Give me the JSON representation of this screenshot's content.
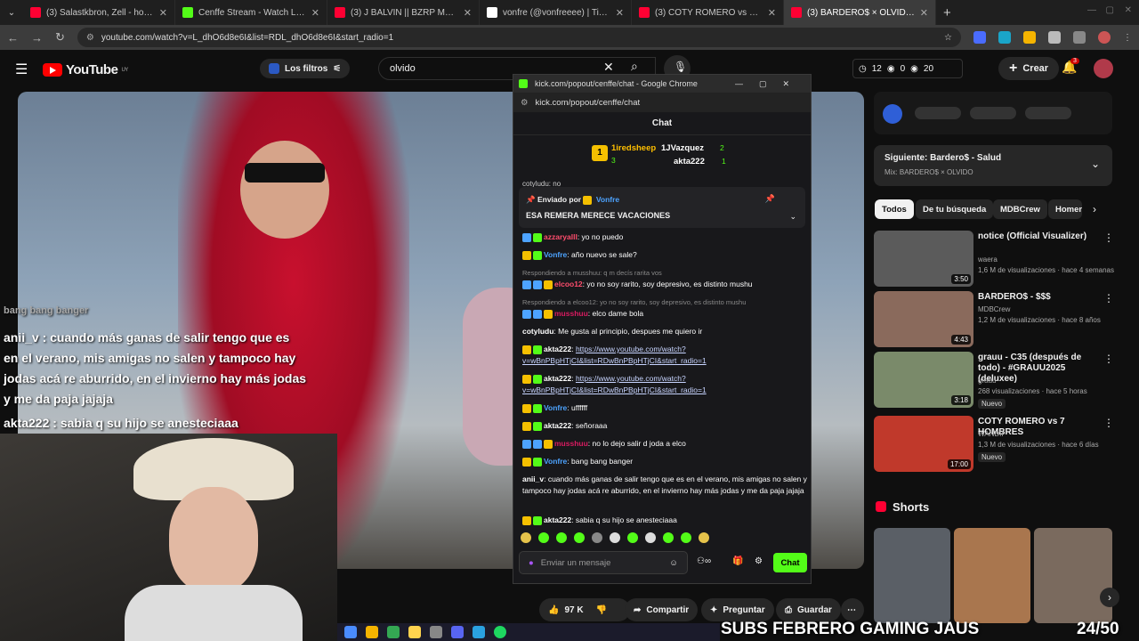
{
  "tabs": [
    {
      "title": "(3) Salastkbron, Zell - hoteles (j...",
      "color": "#ff0033"
    },
    {
      "title": "Cenffe Stream - Watch Live on K...",
      "color": "#53fc18"
    },
    {
      "title": "(3) J BALVIN || BZRP Music Sess...",
      "color": "#ff0033"
    },
    {
      "title": "vonfre (@vonfreeee) | TikTok",
      "color": "#ffffff"
    },
    {
      "title": "(3) COTY ROMERO vs 7 HOMBR...",
      "color": "#ff0033"
    },
    {
      "title": "(3) BARDERO$ × OLVIDO - YouT...",
      "color": "#ff0033"
    }
  ],
  "browser": {
    "url": "youtube.com/watch?v=L_dhO6d8e6I&list=RDL_dhO6d8e6I&start_radio=1"
  },
  "youtube": {
    "logo": "YouTube",
    "region": "UY",
    "filters_label": "Los filtros",
    "search_value": "olvido",
    "header_counts": [
      "12",
      "0",
      "20"
    ],
    "create_label": "Crear",
    "notif_count": "3"
  },
  "overlay": {
    "line1": "anii_v : cuando más ganas de salir tengo que es",
    "line2": "en el verano, mis amigas no salen y tampoco hay",
    "line3": "jodas acá re aburrido, en el invierno hay más jodas",
    "line4": "y me da paja jajaja",
    "line5": "akta222 : sabia q su hijo se anesteciaaa",
    "subs_banner": "SUBS FEBRERO GAMING JAUS",
    "subs_count": "24/50"
  },
  "kick": {
    "window_title": "kick.com/popout/cenffe/chat - Google Chrome",
    "url": "kick.com/popout/cenffe/chat",
    "header": "Chat",
    "leaders": [
      {
        "name": "1iredsheep",
        "count": "3"
      },
      {
        "name": "1JVazquez",
        "count": "2"
      },
      {
        "name": "akta222",
        "count": "1"
      }
    ],
    "pinned_by_label": "Enviado por",
    "pinned_by_user": "Vonfre",
    "pinned_text": "ESA REMERA MERECE VACACIONES",
    "cut_top": "cotyludu: no",
    "messages": [
      {
        "user": "azzaryalll",
        "text": ": yo no puedo",
        "color": "#ff4d6d"
      },
      {
        "user": "Vonfre",
        "text": ": año nuevo se sale?",
        "color": "#4da3ff"
      },
      {
        "reply": "Respondiendo a musshuu: q m decís rarita vos"
      },
      {
        "user": "elcoo12",
        "text": ": yo no soy rarito, soy depresivo, es distinto mushu",
        "color": "#ff4d6d"
      },
      {
        "reply": "Respondiendo a elcoo12: yo no soy rarito, soy depresivo, es distinto mushu"
      },
      {
        "user": "musshuu",
        "text": ": elco dame bola",
        "color": "#d81b60"
      },
      {
        "user": "cotyludu",
        "text": ": Me gusta al principio, despues me quiero ir",
        "color": "#ffffff"
      },
      {
        "user": "akta222",
        "text": ": ",
        "link": "https://www.youtube.com/watch?v=wBnPBpHTjCI&list=RDwBnPBpHTjCI&start_radio=1",
        "color": "#ffffff"
      },
      {
        "user": "akta222",
        "text": ": ",
        "link": "https://www.youtube.com/watch?v=wBnPBpHTjCI&list=RDwBnPBpHTjCI&start_radio=1",
        "color": "#ffffff"
      },
      {
        "user": "Vonfre",
        "text": ": uffffff",
        "color": "#4da3ff"
      },
      {
        "user": "akta222",
        "text": ": señoraaa",
        "color": "#ffffff"
      },
      {
        "user": "musshuu",
        "text": ": no lo dejo salir d joda a elco",
        "color": "#d81b60"
      },
      {
        "user": "Vonfre",
        "text": ": bang bang banger",
        "color": "#4da3ff"
      },
      {
        "user": "anii_v",
        "text": ": cuando más ganas de salir tengo que es en el verano, mis amigas no salen y tampoco hay jodas acá re aburrido, en el invierno hay más jodas y me da paja jajaja",
        "color": "#ffffff"
      },
      {
        "user": "akta222",
        "text": ": sabia q su hijo se anesteciaaa",
        "color": "#ffffff"
      }
    ],
    "input_placeholder": "Enviar un mensaje",
    "chat_button": "Chat"
  },
  "sidebar": {
    "next_label": "Siguiente: Bardero$ - Salud",
    "next_sub": "Mix: BARDERO$ × OLVIDO",
    "chips": [
      "Todos",
      "De tu búsqueda",
      "MDBCrew",
      "Homen"
    ],
    "videos": [
      {
        "title": "notice (Official Visualizer)",
        "channel": "waera",
        "meta": "1,6 M de visualizaciones · hace 4 semanas",
        "duration": "3:50",
        "badge": "",
        "thumb": "#5b5b5b"
      },
      {
        "title": "BARDERO$ - $$$",
        "channel": "MDBCrew",
        "meta": "1,2 M de visualizaciones · hace 8 años",
        "duration": "4:43",
        "badge": "",
        "thumb": "#8a6a5c"
      },
      {
        "title": "grauu - C35 (después de todo) - #GRAUU2025 (deluxee)",
        "channel": "grauu",
        "meta": "268 visualizaciones · hace 5 horas",
        "duration": "3:18",
        "badge": "Nuevo",
        "thumb": "#7a8a6a"
      },
      {
        "title": "COTY ROMERO vs 7 HOMBRES",
        "channel": "WANDII",
        "meta": "1,3 M de visualizaciones · hace 6 días",
        "duration": "17:00",
        "badge": "Nuevo",
        "thumb": "#c0392b"
      }
    ],
    "shorts_label": "Shorts"
  },
  "actions": {
    "likes": "97 K",
    "share": "Compartir",
    "ask": "Preguntar",
    "save": "Guardar"
  }
}
